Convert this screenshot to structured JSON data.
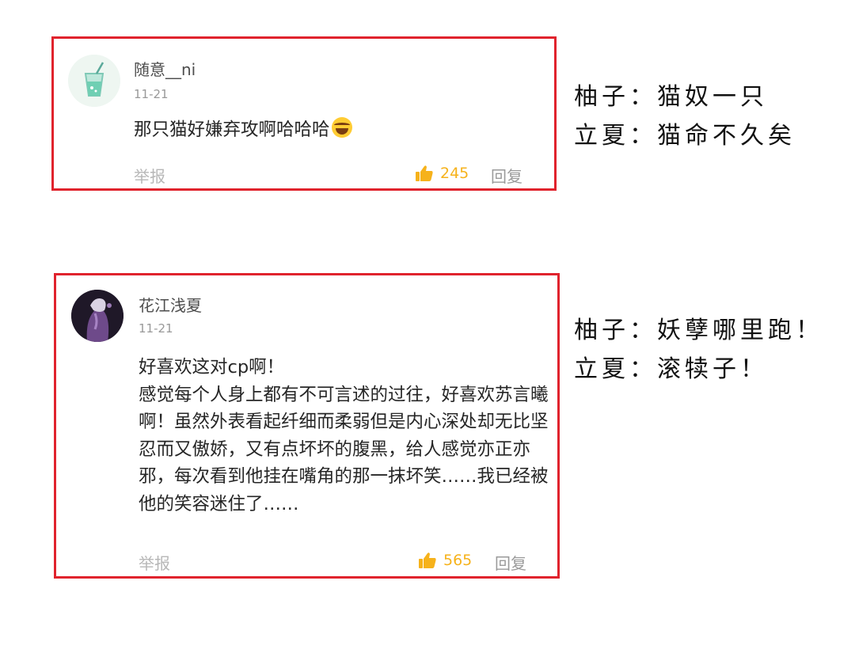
{
  "comments": [
    {
      "username": "随意__ni",
      "date": "11-21",
      "text": "那只猫好嫌弃攻啊哈哈哈",
      "report_label": "举报",
      "likes": "245",
      "reply_label": "回复",
      "avatar_icon": "drink-cup-avatar-icon"
    },
    {
      "username": "花江浅夏",
      "date": "11-21",
      "text": "好喜欢这对cp啊！\n感觉每个人身上都有不可言述的过往，好喜欢苏言曦啊！虽然外表看起纤细而柔弱但是内心深处却无比坚忍而又傲娇，又有点坏坏的腹黑，给人感觉亦正亦邪，每次看到他挂在嘴角的那一抹坏笑……我已经被他的笑容迷住了……",
      "report_label": "举报",
      "likes": "565",
      "reply_label": "回复",
      "avatar_icon": "anime-character-avatar-icon"
    }
  ],
  "annotations": [
    {
      "line1": "柚子：猫奴一只",
      "line2": "立夏：猫命不久矣"
    },
    {
      "line1": "柚子：妖孽哪里跑！",
      "line2": "立夏：滚犊子！"
    }
  ],
  "colors": {
    "border": "#e0232d",
    "like": "#f6b21b",
    "muted": "#b7b7b7"
  }
}
